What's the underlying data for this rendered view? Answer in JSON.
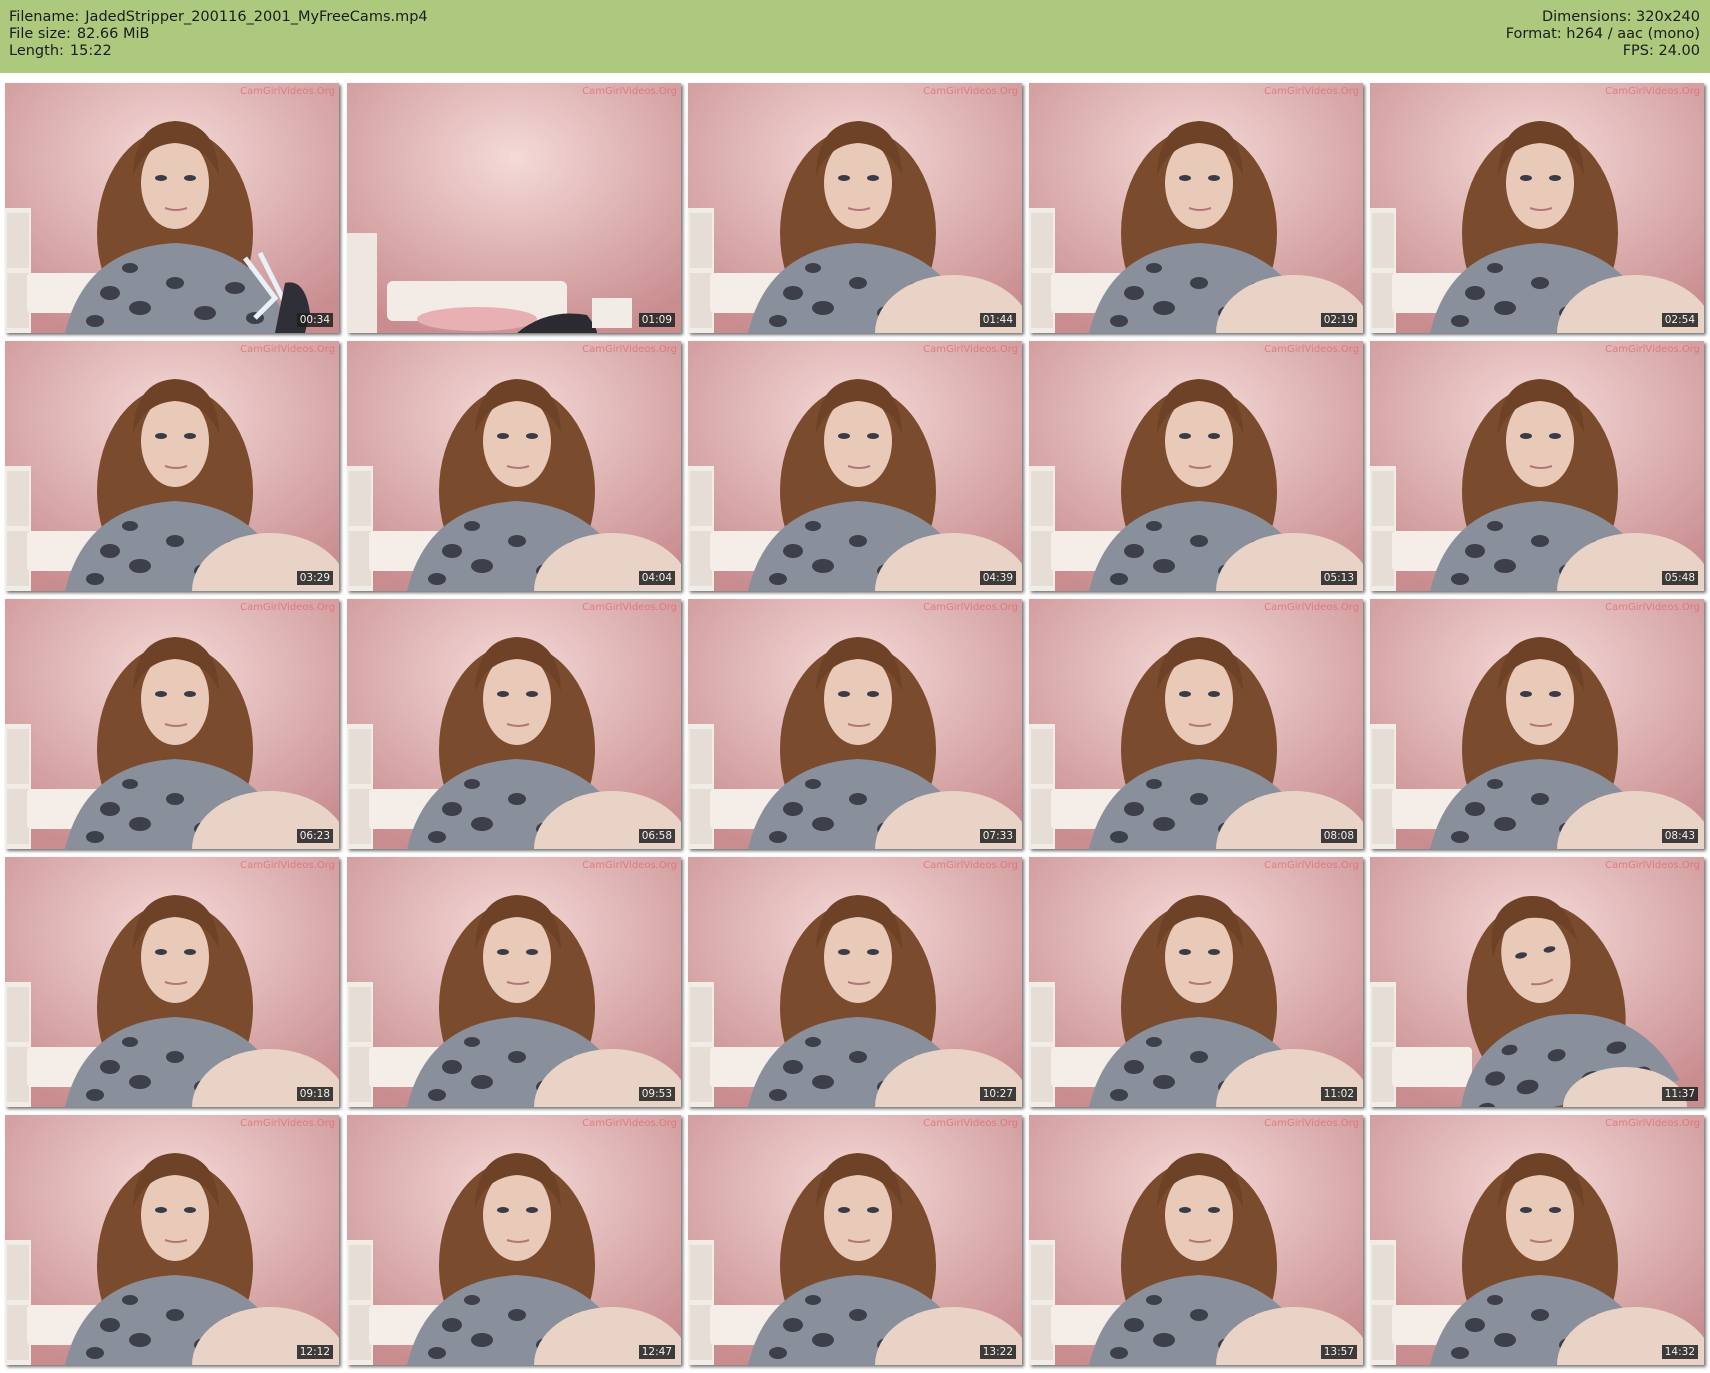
{
  "info": {
    "filename_label": "Filename:",
    "filename": "JadedStripper_200116_2001_MyFreeCams.mp4",
    "filesize_label": "File size:",
    "filesize": "82.66 MiB",
    "length_label": "Length:",
    "length": "15:22",
    "dimensions": "Dimensions: 320x240",
    "format": "Format: h264 / aac (mono)",
    "fps": "FPS: 24.00"
  },
  "watermark": "CamGirlVideos.Org",
  "thumbnails": [
    {
      "time": "00:34",
      "scene": "girl-toy"
    },
    {
      "time": "01:09",
      "scene": "empty-room"
    },
    {
      "time": "01:44",
      "scene": "girl-knee"
    },
    {
      "time": "02:19",
      "scene": "girl-knee"
    },
    {
      "time": "02:54",
      "scene": "girl-knee"
    },
    {
      "time": "03:29",
      "scene": "girl-knee"
    },
    {
      "time": "04:04",
      "scene": "girl-knee"
    },
    {
      "time": "04:39",
      "scene": "girl-knee"
    },
    {
      "time": "05:13",
      "scene": "girl-knee"
    },
    {
      "time": "05:48",
      "scene": "girl-knee"
    },
    {
      "time": "06:23",
      "scene": "girl-knee"
    },
    {
      "time": "06:58",
      "scene": "girl-knee"
    },
    {
      "time": "07:33",
      "scene": "girl-knee"
    },
    {
      "time": "08:08",
      "scene": "girl-knee"
    },
    {
      "time": "08:43",
      "scene": "girl-knee"
    },
    {
      "time": "09:18",
      "scene": "girl-knee"
    },
    {
      "time": "09:53",
      "scene": "girl-knee"
    },
    {
      "time": "10:27",
      "scene": "girl-knee"
    },
    {
      "time": "11:02",
      "scene": "girl-knee"
    },
    {
      "time": "11:37",
      "scene": "girl-tilted"
    },
    {
      "time": "12:12",
      "scene": "girl-knee"
    },
    {
      "time": "12:47",
      "scene": "girl-knee"
    },
    {
      "time": "13:22",
      "scene": "girl-knee"
    },
    {
      "time": "13:57",
      "scene": "girl-knee"
    },
    {
      "time": "14:32",
      "scene": "girl-knee"
    }
  ]
}
